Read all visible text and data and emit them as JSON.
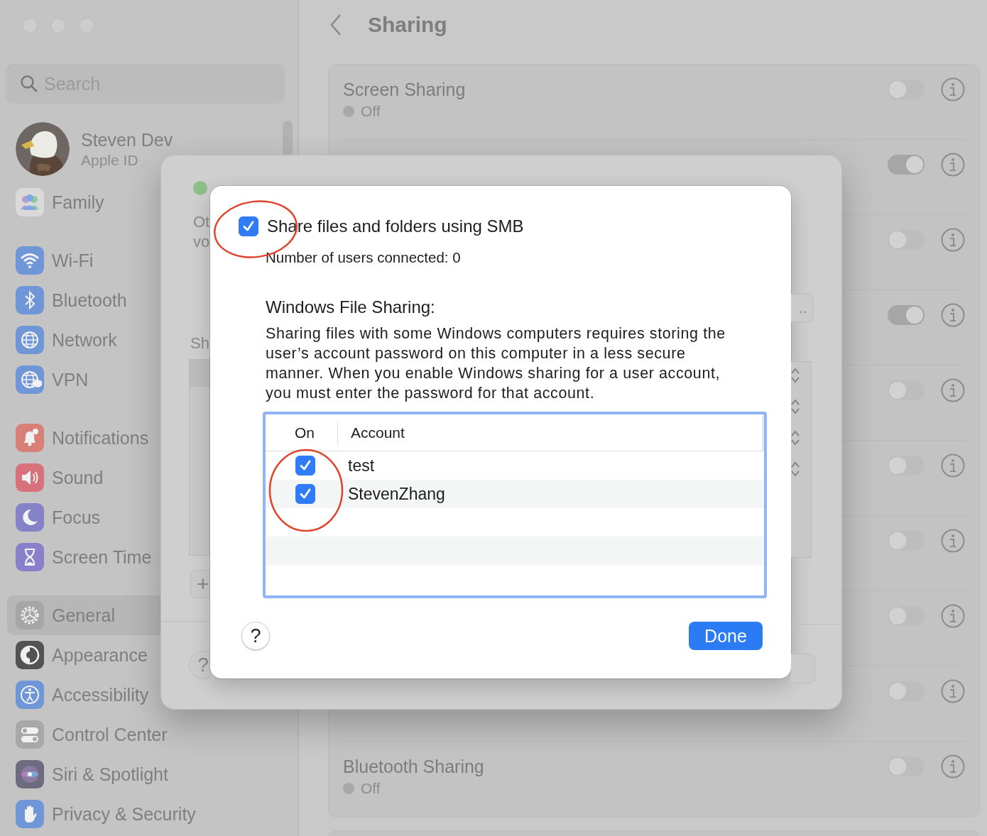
{
  "sidebar": {
    "search": {
      "placeholder": "Search"
    },
    "profile": {
      "name": "Steven Dev",
      "subtitle": "Apple ID"
    },
    "groups": [
      {
        "items": [
          {
            "label": "Family",
            "kind": "family",
            "color": "#dadada",
            "selected": false
          }
        ]
      },
      {
        "items": [
          {
            "label": "Wi-Fi",
            "kind": "wifi",
            "color": "#6f96d6",
            "selected": false
          },
          {
            "label": "Bluetooth",
            "kind": "bluetooth",
            "color": "#6f96d6",
            "selected": false
          },
          {
            "label": "Network",
            "kind": "globe",
            "color": "#6f96d6",
            "selected": false
          },
          {
            "label": "VPN",
            "kind": "vpn",
            "color": "#6f96d6",
            "selected": false
          }
        ]
      },
      {
        "items": [
          {
            "label": "Notifications",
            "kind": "bell",
            "color": "#d87f77",
            "selected": false
          },
          {
            "label": "Sound",
            "kind": "speaker",
            "color": "#d7727d",
            "selected": false
          },
          {
            "label": "Focus",
            "kind": "moon",
            "color": "#8582c8",
            "selected": false
          },
          {
            "label": "Screen Time",
            "kind": "hourglass",
            "color": "#8a80ca",
            "selected": false
          }
        ]
      },
      {
        "items": [
          {
            "label": "General",
            "kind": "gear",
            "color": "#a6a6a6",
            "selected": true
          },
          {
            "label": "Appearance",
            "kind": "appearance",
            "color": "#535353",
            "selected": false
          },
          {
            "label": "Accessibility",
            "kind": "accessibility",
            "color": "#6f96d6",
            "selected": false
          },
          {
            "label": "Control Center",
            "kind": "switches",
            "color": "#a8a8a8",
            "selected": false
          },
          {
            "label": "Siri & Spotlight",
            "kind": "siri",
            "color": "#6e6a80",
            "selected": false
          },
          {
            "label": "Privacy & Security",
            "kind": "hand",
            "color": "#6f96d6",
            "selected": false
          }
        ]
      }
    ]
  },
  "main": {
    "title": "Sharing",
    "rows": [
      {
        "title": "Screen Sharing",
        "status": "Off",
        "on": false
      },
      {
        "on": true
      },
      {
        "on": false
      },
      {
        "on": true
      },
      {
        "on": false
      },
      {
        "on": false
      },
      {
        "on": false
      },
      {
        "on": false
      },
      {
        "on": false
      },
      {
        "title": "Bluetooth Sharing",
        "status": "Off",
        "on": false
      }
    ]
  },
  "sheet": {
    "left_texts": [
      "Ot",
      "vo"
    ],
    "section_fragment": "Sh",
    "add_button": "+",
    "help_button": "?",
    "more_button": ".."
  },
  "dialog": {
    "smb": {
      "label": "Share files and folders using SMB",
      "checked": true
    },
    "users_connected": "Number of users connected: 0",
    "section_title": "Windows File Sharing:",
    "description": "Sharing files with some Windows computers requires storing the user’s account password on this computer in a less secure manner. When you enable Windows sharing for a user account, you must enter the password for that account.",
    "table": {
      "columns": [
        "On",
        "Account"
      ],
      "rows": [
        {
          "on": true,
          "account": "test"
        },
        {
          "on": true,
          "account": "StevenZhang"
        }
      ]
    },
    "help_button": "?",
    "done_button": "Done"
  },
  "markup": [
    {
      "kind": "ellipse"
    },
    {
      "kind": "ellipse"
    }
  ]
}
